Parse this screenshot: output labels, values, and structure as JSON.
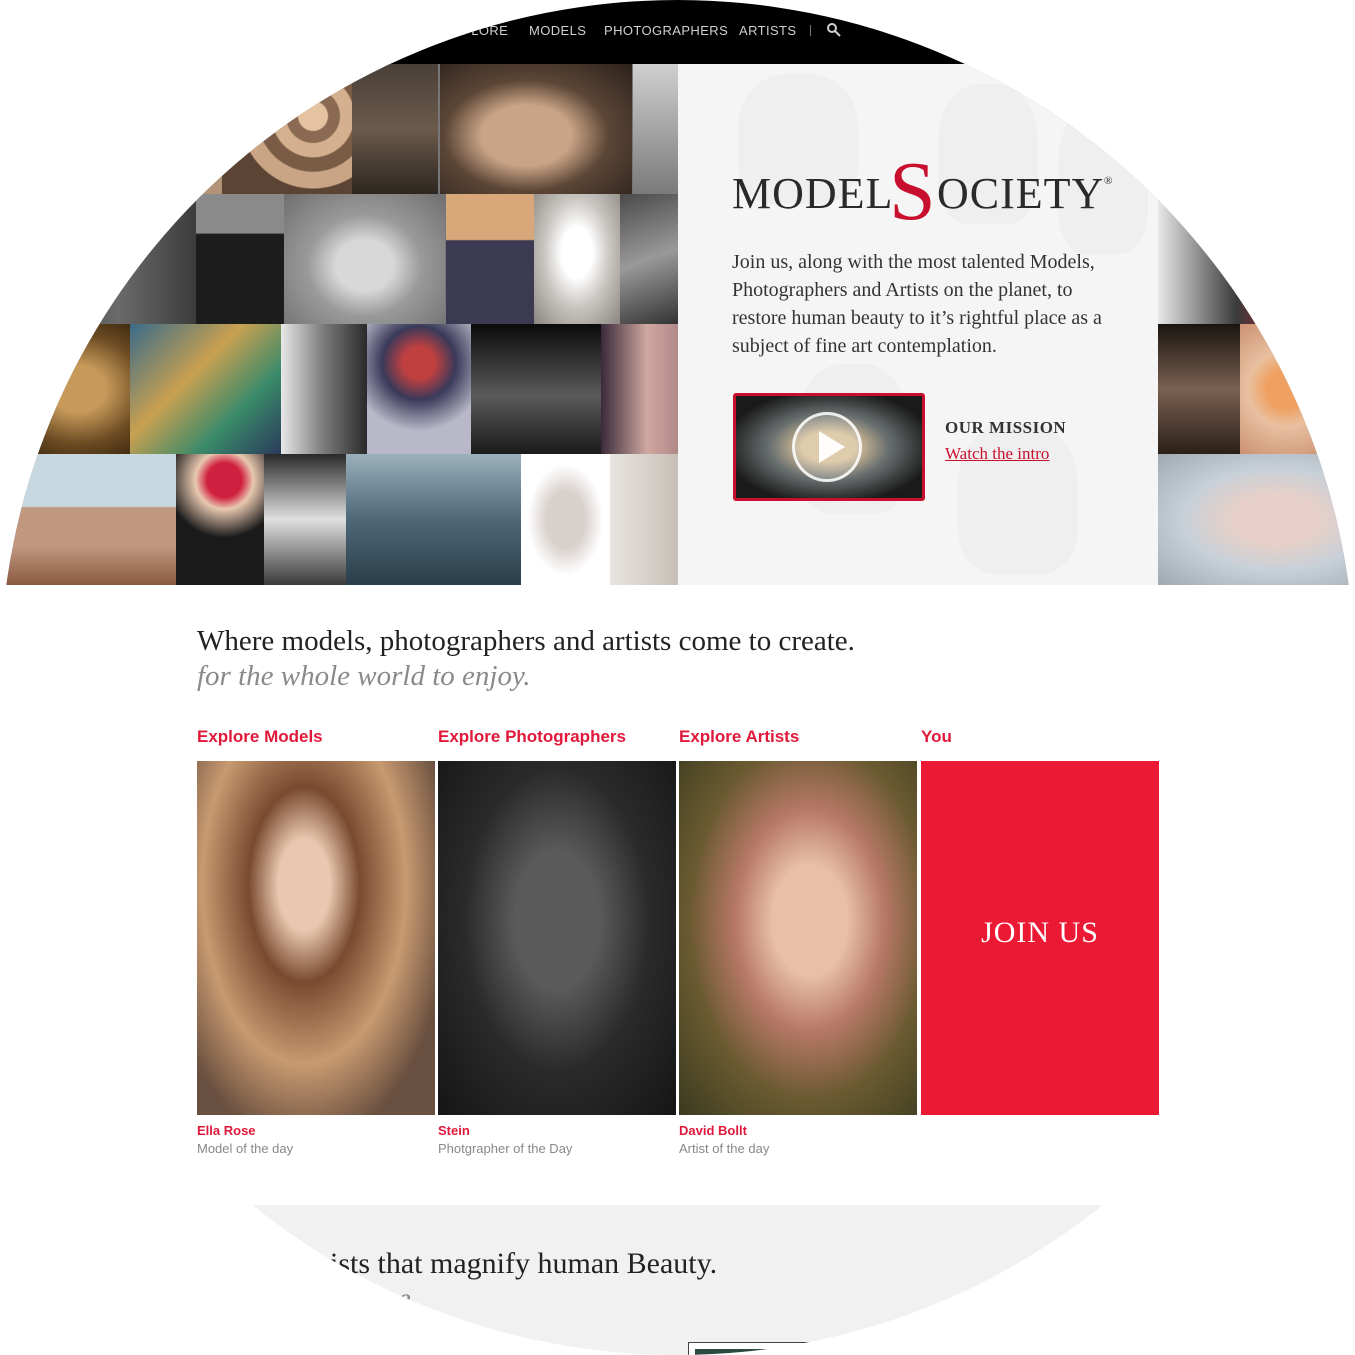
{
  "nav": {
    "items": [
      "EXPLORE",
      "MODELS",
      "PHOTOGRAPHERS",
      "ARTISTS"
    ]
  },
  "hero": {
    "logo": {
      "model": "MODEL",
      "s": "S",
      "ociety": "OCIETY",
      "reg": "®"
    },
    "intro": "Join us, along with the most talented Models, Photographers and Artists on the planet, to restore human beauty to it’s rightful place as a subject of fine art contemplation.",
    "mission_title": "OUR MISSION",
    "mission_link": "Watch the intro"
  },
  "tagline": {
    "main": "Where models, photographers and artists come to create.",
    "sub": "for the whole world to enjoy."
  },
  "columns": [
    {
      "heading": "Explore Models",
      "name": "Ella Rose",
      "caption": "Model of the day"
    },
    {
      "heading": "Explore Photographers",
      "name": "Stein",
      "caption": "Photgrapher of the Day"
    },
    {
      "heading": "Explore Artists",
      "name": "David Bollt",
      "caption": "Artist of the day"
    },
    {
      "heading": "You",
      "join": "JOIN US"
    }
  ],
  "bottom": {
    "title": "…ists that magnify human Beauty.",
    "sub": "…r home"
  },
  "colors": {
    "accent": "#ec1935",
    "nav_bg": "#000000"
  }
}
